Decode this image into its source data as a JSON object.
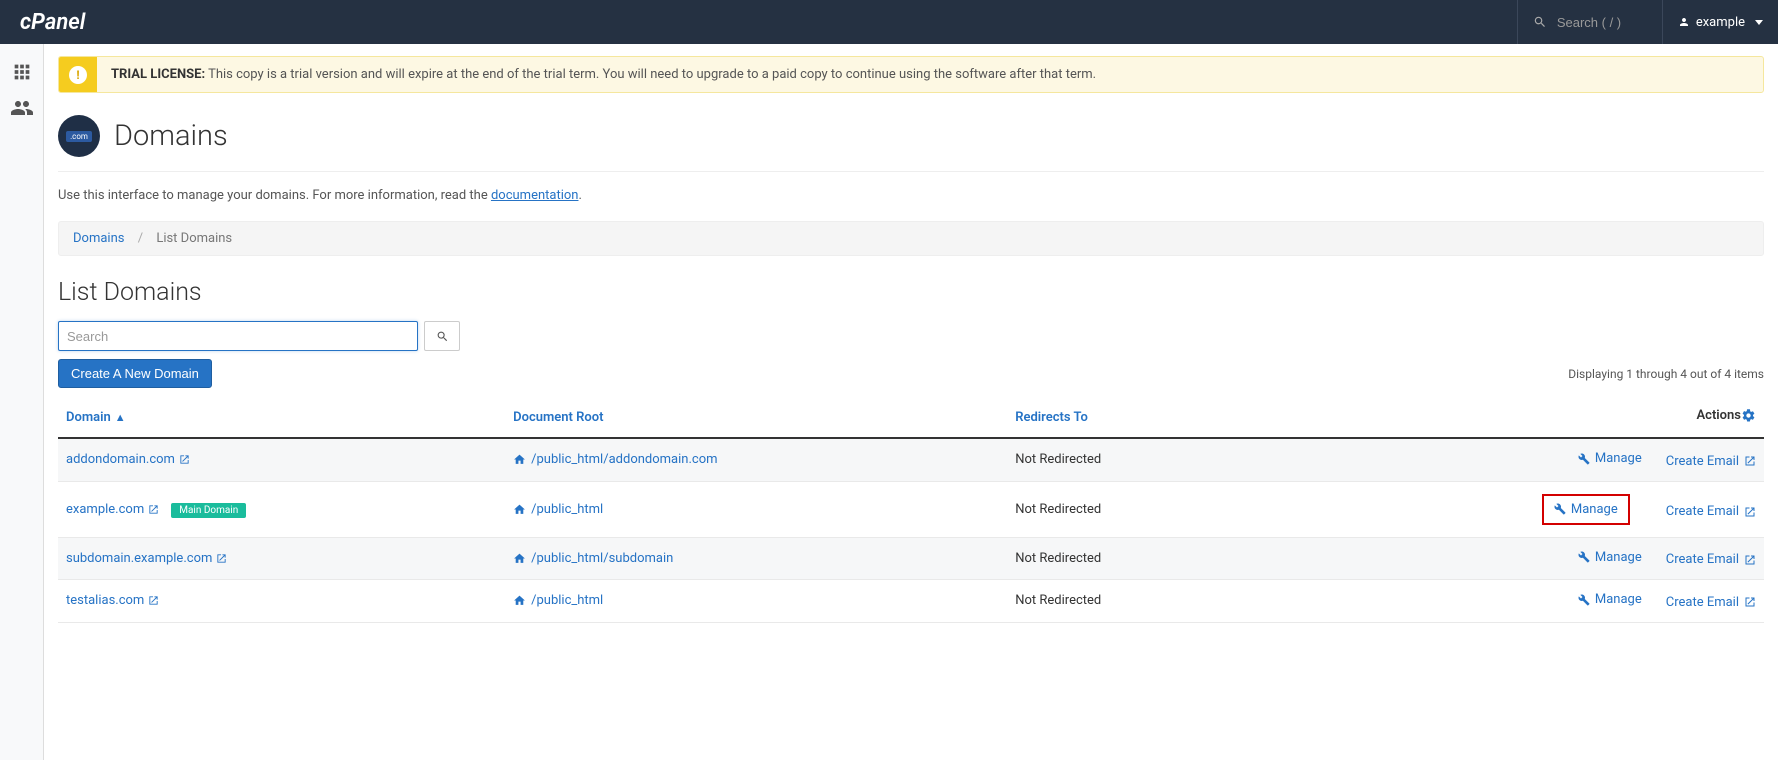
{
  "navbar": {
    "search_placeholder": "Search ( / )",
    "user_label": "example"
  },
  "alert": {
    "strong": "TRIAL LICENSE:",
    "text": " This copy is a trial version and will expire at the end of the trial term. You will need to upgrade to a paid copy to continue using the software after that term."
  },
  "page_title": "Domains",
  "intro": {
    "prefix": "Use this interface to manage your domains. For more information, read the ",
    "link": "documentation",
    "suffix": "."
  },
  "breadcrumb": {
    "root": "Domains",
    "current": "List Domains"
  },
  "section_heading": "List Domains",
  "search_placeholder": "Search",
  "create_button": "Create A New Domain",
  "status_text": "Displaying 1 through 4 out of 4 items",
  "columns": {
    "domain": "Domain",
    "docroot": "Document Root",
    "redirects": "Redirects To",
    "actions": "Actions"
  },
  "labels": {
    "manage": "Manage",
    "create_email": "Create Email",
    "main_domain": "Main Domain"
  },
  "rows": [
    {
      "domain": "addondomain.com",
      "docroot": "/public_html/addondomain.com",
      "redirects": "Not Redirected",
      "main": false,
      "highlight": false
    },
    {
      "domain": "example.com",
      "docroot": "/public_html",
      "redirects": "Not Redirected",
      "main": true,
      "highlight": true
    },
    {
      "domain": "subdomain.example.com",
      "docroot": "/public_html/subdomain",
      "redirects": "Not Redirected",
      "main": false,
      "highlight": false
    },
    {
      "domain": "testalias.com",
      "docroot": "/public_html",
      "redirects": "Not Redirected",
      "main": false,
      "highlight": false
    }
  ]
}
